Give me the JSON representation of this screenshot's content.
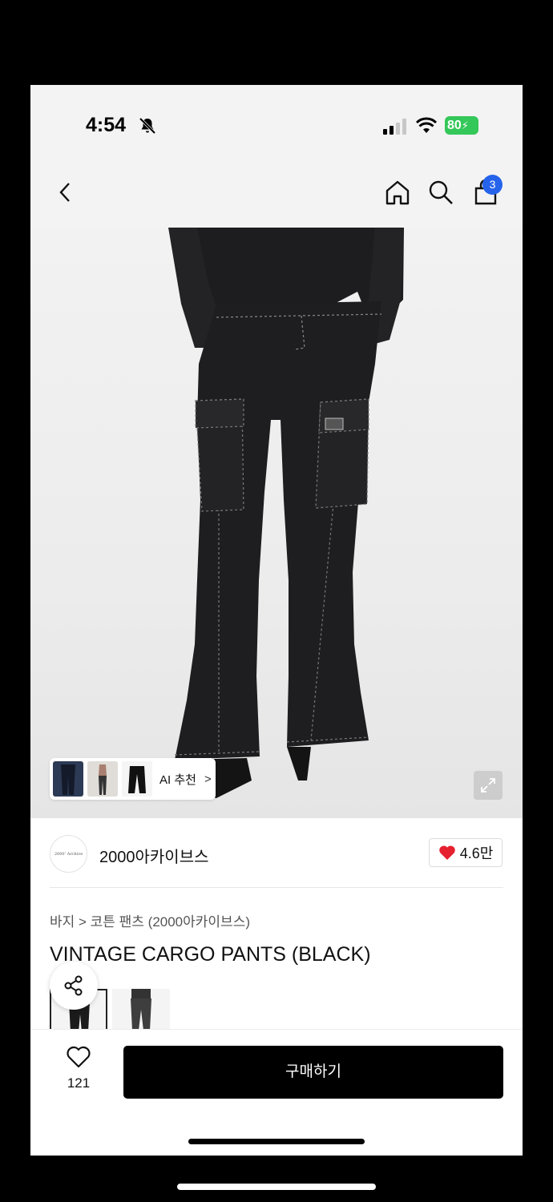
{
  "status_bar": {
    "time": "4:54",
    "battery": "80"
  },
  "header": {
    "back_icon": "chevron-left-icon",
    "home_icon": "home-icon",
    "search_icon": "search-icon",
    "bag_icon": "shopping-bag-icon",
    "cart_count": "3"
  },
  "hero": {
    "recommend_label": "AI 추천",
    "recommend_arrow": ">",
    "expand_icon": "expand-icon"
  },
  "brand": {
    "logo_text": "2000’ Archive",
    "name": "2000아카이브스",
    "like_count": "4.6만",
    "heart_color": "#e5202f"
  },
  "product": {
    "breadcrumb": "바지 > 코튼 팬츠 (2000아카이브스)",
    "title": "VINTAGE CARGO PANTS (BLACK)"
  },
  "bottom_bar": {
    "wish_count": "121",
    "buy_label": "구매하기"
  },
  "colors": {
    "badge": "#2563eb",
    "battery": "#34c759"
  }
}
